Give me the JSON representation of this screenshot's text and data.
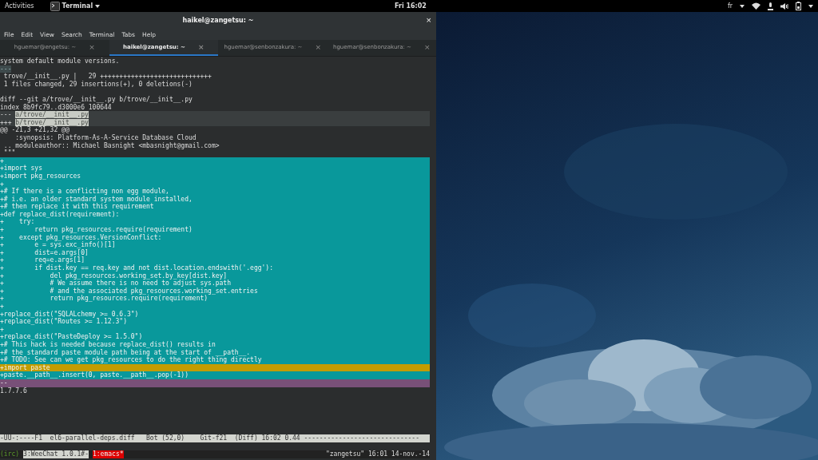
{
  "top_bar": {
    "activities": "Activities",
    "app": "Terminal",
    "clock": "Fri 16:02",
    "keyboard": "fr"
  },
  "window": {
    "title": "haikel@zangetsu: ~",
    "close": "×"
  },
  "menu": [
    "File",
    "Edit",
    "View",
    "Search",
    "Terminal",
    "Tabs",
    "Help"
  ],
  "tabs": [
    {
      "label": "hguemar@engetsu: ~",
      "selected": false,
      "close": "×"
    },
    {
      "label": "haikel@zangetsu: ~",
      "selected": true,
      "close": "×"
    },
    {
      "label": "hguemar@senbonzakura: ~",
      "selected": false,
      "close": "×"
    },
    {
      "label": "hguemar@senbonzakura: ~",
      "selected": false,
      "close": "×"
    }
  ],
  "lines": [
    {
      "kind": "plain",
      "text": "system default module versions."
    },
    {
      "kind": "mark",
      "text": "---"
    },
    {
      "kind": "plain",
      "text": " trove/__init__.py |   29 +++++++++++++++++++++++++++++"
    },
    {
      "kind": "plain",
      "text": " 1 files changed, 29 insertions(+), 0 deletions(-)"
    },
    {
      "kind": "blank"
    },
    {
      "kind": "plain",
      "text": "diff --git a/trove/__init__.py b/trove/__init__.py"
    },
    {
      "kind": "plain",
      "text": "index 8b9fc79..d3000e6 100644"
    },
    {
      "kind": "file",
      "marker": "---",
      "text": "a/trove/__init__.py"
    },
    {
      "kind": "file",
      "marker": "+++",
      "text": "b/trove/__init__.py"
    },
    {
      "kind": "plain",
      "text": "@@ -21,3 +21,32 @@"
    },
    {
      "kind": "plain",
      "text": "    :synopsis: Platform-As-A-Service Database Cloud"
    },
    {
      "kind": "plain",
      "text": " .. moduleauthor:: Michael Basnight <mbasnight@gmail.com>"
    },
    {
      "kind": "plain",
      "text": " \"\"\""
    },
    {
      "kind": "added",
      "text": "+"
    },
    {
      "kind": "added",
      "text": "+import sys"
    },
    {
      "kind": "added",
      "text": "+import pkg_resources"
    },
    {
      "kind": "added",
      "text": "+"
    },
    {
      "kind": "added",
      "text": "+# If there is a conflicting non egg module,"
    },
    {
      "kind": "added",
      "text": "+# i.e. an older standard system module installed,"
    },
    {
      "kind": "added",
      "text": "+# then replace it with this requirement"
    },
    {
      "kind": "added",
      "text": "+def replace_dist(requirement):"
    },
    {
      "kind": "added",
      "text": "+    try:"
    },
    {
      "kind": "added",
      "text": "+        return pkg_resources.require(requirement)"
    },
    {
      "kind": "added",
      "text": "+    except pkg_resources.VersionConflict:"
    },
    {
      "kind": "added",
      "text": "+        e = sys.exc_info()[1]"
    },
    {
      "kind": "added",
      "text": "+        dist=e.args[0]"
    },
    {
      "kind": "added",
      "text": "+        req=e.args[1]"
    },
    {
      "kind": "added",
      "text": "+        if dist.key == req.key and not dist.location.endswith('.egg'):"
    },
    {
      "kind": "added",
      "text": "+            del pkg_resources.working_set.by_key[dist.key]"
    },
    {
      "kind": "added",
      "text": "+            # We assume there is no need to adjust sys.path"
    },
    {
      "kind": "added",
      "text": "+            # and the associated pkg_resources.working_set.entries"
    },
    {
      "kind": "added",
      "text": "+            return pkg_resources.require(requirement)"
    },
    {
      "kind": "added",
      "text": "+"
    },
    {
      "kind": "added",
      "text": "+replace_dist(\"SQLALchemy >= 0.6.3\")"
    },
    {
      "kind": "added",
      "text": "+replace_dist(\"Routes >= 1.12.3\")"
    },
    {
      "kind": "added",
      "text": "+"
    },
    {
      "kind": "added",
      "text": "+replace_dist(\"PasteDeploy >= 1.5.0\")"
    },
    {
      "kind": "added",
      "text": "+# This hack is needed because replace_dist() results in"
    },
    {
      "kind": "added",
      "text": "+# the standard paste module path being at the start of __path__."
    },
    {
      "kind": "added",
      "text": "+# TODO: See can we get pkg_resources to do the right thing directly"
    },
    {
      "kind": "current",
      "text": "+import paste"
    },
    {
      "kind": "added",
      "text": "+paste.__path__.insert(0, paste.__path__.pop(-1))"
    },
    {
      "kind": "signature",
      "text": "--"
    },
    {
      "kind": "plain",
      "text": "1.7.7.6"
    }
  ],
  "mode_line": "-UU-:----F1  el6-parallel-deps.diff   Bot (52,0)    Git-f21  (Diff) 16:02 0.44 ------------------------------",
  "tmux": {
    "session": "(irc)",
    "windows": [
      {
        "label": "3:WeeChat 1.0.1#-",
        "selected": false
      },
      {
        "label": "1:emacs*",
        "selected": true
      }
    ],
    "status": "\"zangetsu\" 16:01 14-nov.-14"
  }
}
